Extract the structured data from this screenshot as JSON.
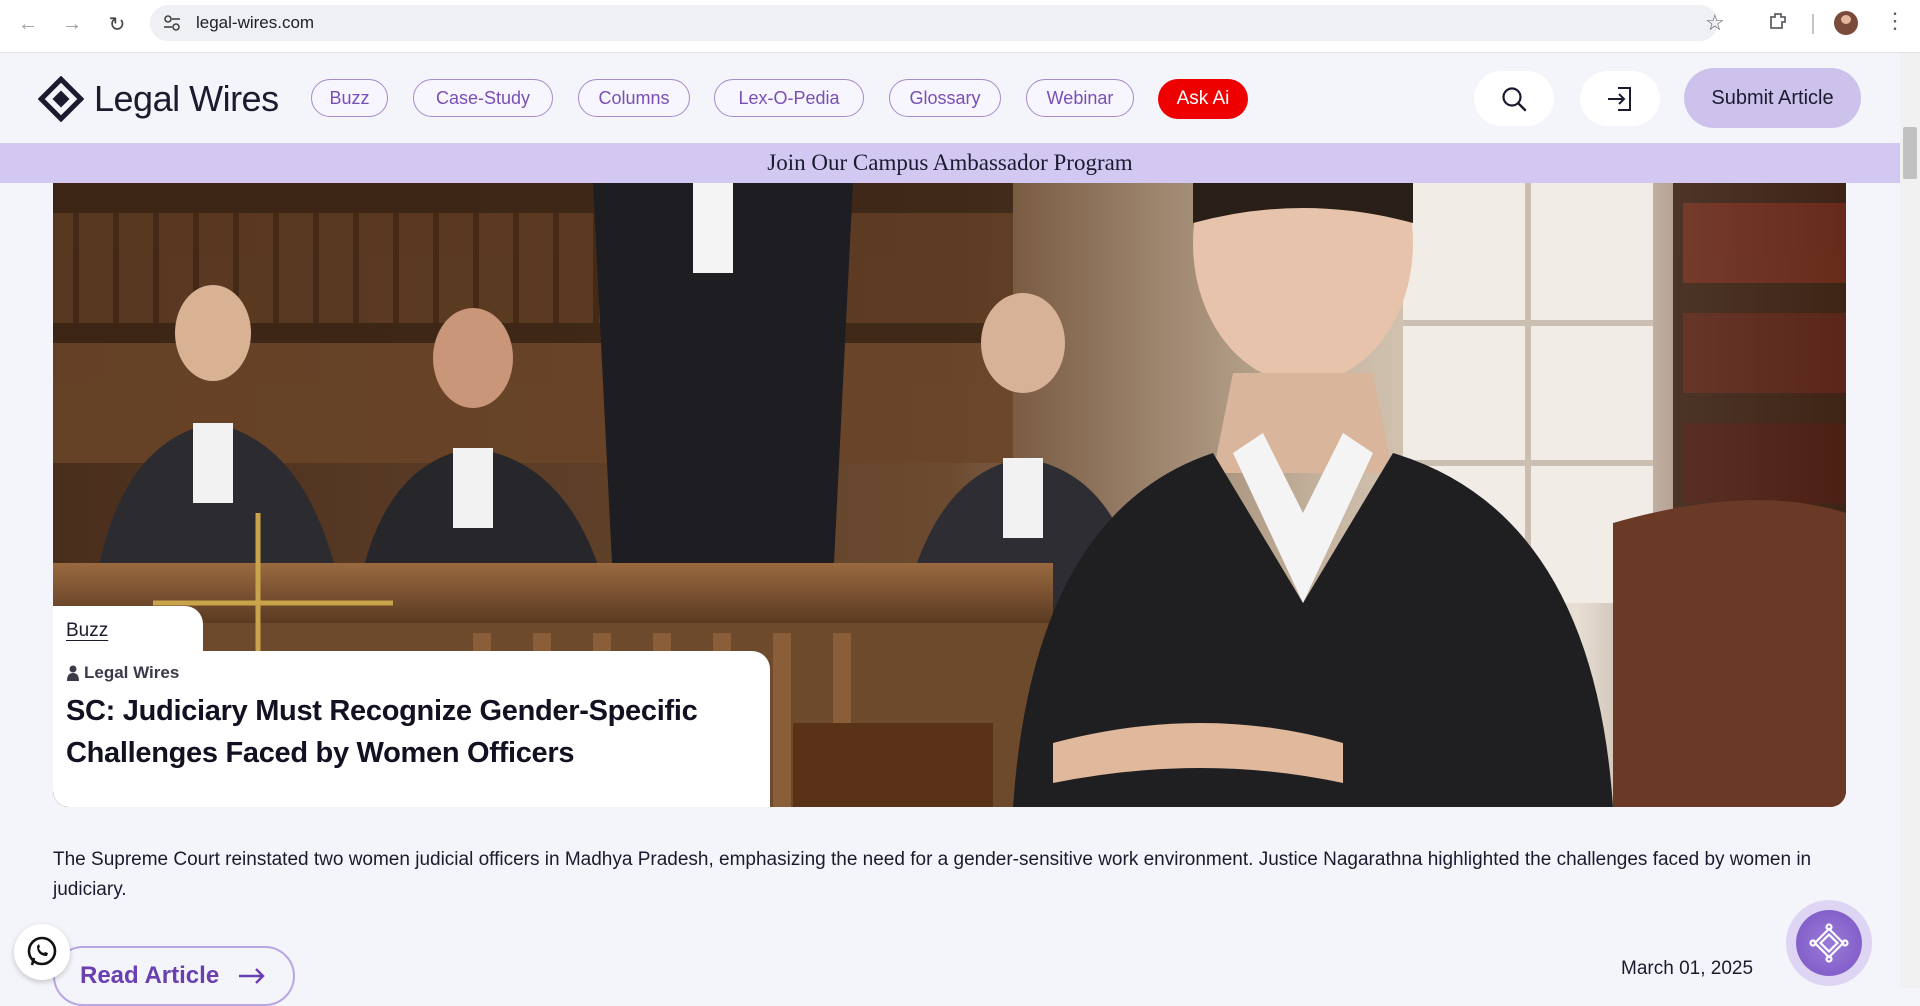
{
  "browser": {
    "url": "legal-wires.com"
  },
  "header": {
    "logo_text": "Legal Wires",
    "nav": [
      {
        "label": "Buzz"
      },
      {
        "label": "Case-Study"
      },
      {
        "label": "Columns"
      },
      {
        "label": "Lex-O-Pedia"
      },
      {
        "label": "Glossary"
      },
      {
        "label": "Webinar"
      }
    ],
    "ask_ai": "Ask Ai",
    "submit_label": "Submit Article"
  },
  "banner": {
    "text": "Join Our Campus Ambassador Program"
  },
  "article": {
    "category": "Buzz",
    "author": "Legal Wires",
    "title": "SC: Judiciary Must Recognize Gender-Specific Challenges Faced by Women Officers",
    "summary": "The Supreme Court reinstated two women judicial officers in Madhya Pradesh, emphasizing the need for a gender-sensitive work environment. Justice Nagarathna highlighted the challenges faced by women in judiciary.",
    "read_label": "Read Article",
    "date": "March 01, 2025"
  },
  "colors": {
    "accent": "#7a4fb5",
    "banner": "#d3c8f1",
    "ask_ai": "#ee0000",
    "submit": "#cdc2ec"
  }
}
